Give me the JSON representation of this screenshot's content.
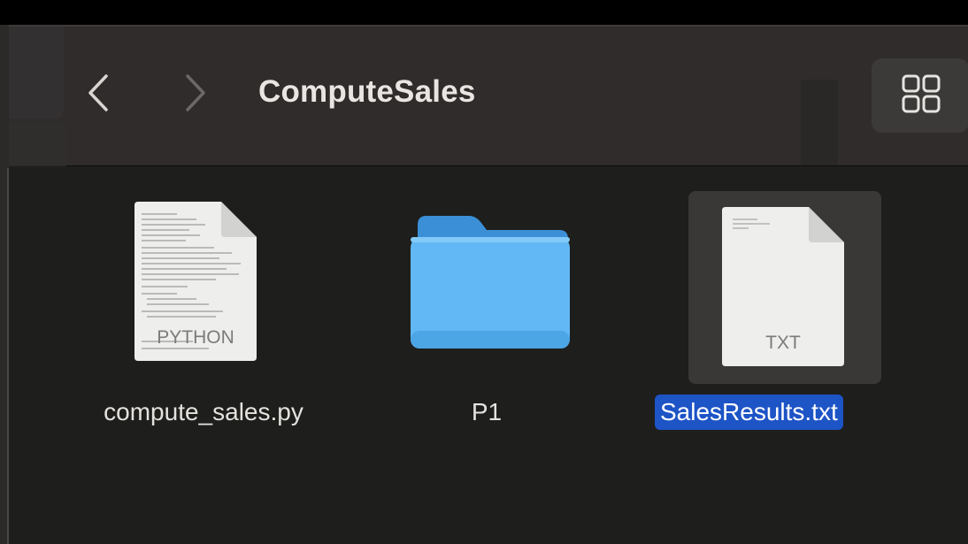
{
  "window": {
    "title": "ComputeSales"
  },
  "toolbar": {
    "back_icon": "chevron-left-icon",
    "forward_icon": "chevron-right-icon",
    "view_icon": "icon-grid-view-icon"
  },
  "files": [
    {
      "name": "compute_sales.py",
      "type": "PYTHON",
      "kind": "document",
      "selected": false
    },
    {
      "name": "P1",
      "kind": "folder",
      "selected": false
    },
    {
      "name": "SalesResults.txt",
      "type": "TXT",
      "kind": "document",
      "selected": true
    }
  ],
  "colors": {
    "selection": "#1d54c6",
    "folder": "#5bb3f0",
    "toolbar": "#2f2c2b",
    "background": "#1e1e1c"
  }
}
